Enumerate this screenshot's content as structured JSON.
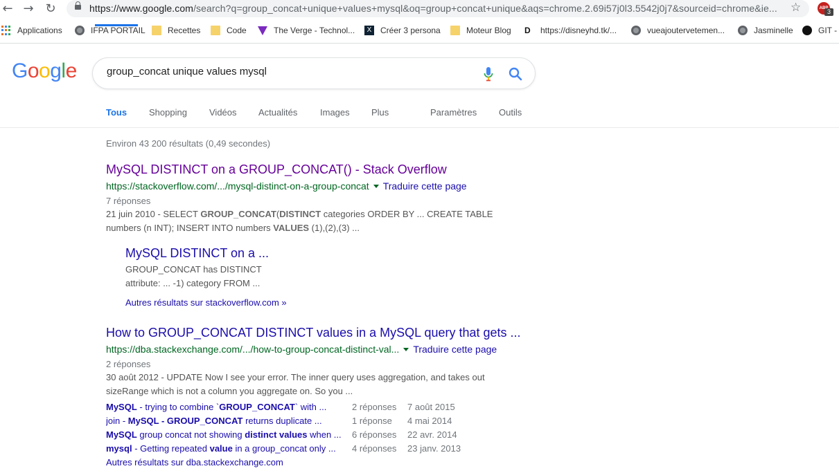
{
  "browser": {
    "url_host": "https://www.google.com",
    "url_path": "/search?q=group_concat+unique+values+mysql&oq=group+concat+unique&aqs=chrome.2.69i57j0l3.5542j0j7&sourceid=chrome&ie...",
    "extension_badge": "3",
    "extension_label": "ABP"
  },
  "bookmarks": [
    {
      "label": "Applications",
      "icon": "apps-grid-icon"
    },
    {
      "label": "IFPA PORTAIL",
      "icon": "globe-icon"
    },
    {
      "label": "Recettes",
      "icon": "folder-icon"
    },
    {
      "label": "Code",
      "icon": "folder-icon"
    },
    {
      "label": "The Verge - Technol...",
      "icon": "verge-icon"
    },
    {
      "label": "Créer 3 persona",
      "icon": "x-persona-icon"
    },
    {
      "label": "Moteur Blog",
      "icon": "folder-icon"
    },
    {
      "label": "https://disneyhd.tk/...",
      "icon": "disney-icon"
    },
    {
      "label": "vueajoutervetemen...",
      "icon": "globe-icon"
    },
    {
      "label": "Jasminelle",
      "icon": "globe-icon"
    },
    {
      "label": "GIT -",
      "icon": "github-icon"
    }
  ],
  "search": {
    "query": "group_concat unique values mysql"
  },
  "tabs": [
    "Tous",
    "Shopping",
    "Vidéos",
    "Actualités",
    "Images",
    "Plus",
    "Paramètres",
    "Outils"
  ],
  "stats": "Environ 43 200 résultats (0,49 secondes)",
  "results": [
    {
      "title": "MySQL DISTINCT on a GROUP_CONCAT() - Stack Overflow",
      "url": "https://stackoverflow.com/.../mysql-distinct-on-a-group-concat",
      "translate": "Traduire cette page",
      "answers": "7 réponses",
      "snippet_line1_date": "21 juin 2010 - SELECT ",
      "snippet_line1_b1": "GROUP_CONCAT",
      "snippet_line1_mid": "(",
      "snippet_line1_b2": "DISTINCT",
      "snippet_line1_end": " categories ORDER BY ... CREATE TABLE",
      "snippet_line2_start": "numbers (n INT); INSERT INTO numbers ",
      "snippet_line2_b": "VALUES",
      "snippet_line2_end": " (1),(2),(3) ...",
      "sub_title": "MySQL DISTINCT on a ...",
      "sub_snippet1": "GROUP_CONCAT has DISTINCT",
      "sub_snippet2": "attribute: ... -1) category FROM ...",
      "more": "Autres résultats sur stackoverflow.com »"
    },
    {
      "title": "How to GROUP_CONCAT DISTINCT values in a MySQL query that gets ...",
      "url": "https://dba.stackexchange.com/.../how-to-group-concat-distinct-val...",
      "translate": "Traduire cette page",
      "answers": "2 réponses",
      "snippet_line1": "30 août 2012 - UPDATE Now I see your error. The inner query uses aggregation, and takes out",
      "snippet_line2": "sizeRange which is not a column you aggregate on. So you ...",
      "more": "Autres résultats sur dba.stackexchange.com"
    }
  ],
  "related": [
    {
      "q_b1": "MySQL",
      "q_t1": " - trying to combine `",
      "q_b2": "GROUP_CONCAT",
      "q_t2": "` with ...",
      "answers": "2 réponses",
      "date": "7 août 2015"
    },
    {
      "q_b1": "",
      "q_t1": "join - ",
      "q_b2": "MySQL - GROUP_CONCAT",
      "q_t2": " returns duplicate ...",
      "answers": "1 réponse",
      "date": "4 mai 2014"
    },
    {
      "q_b1": "MySQL",
      "q_t1": " group concat not showing ",
      "q_b2": "distinct values",
      "q_t2": " when ...",
      "answers": "6 réponses",
      "date": "22 avr. 2014"
    },
    {
      "q_b1": "mysql",
      "q_t1": " - Getting repeated ",
      "q_b2": "value",
      "q_t2": " in a group_concat only ...",
      "answers": "4 réponses",
      "date": "23 janv. 2013"
    }
  ]
}
